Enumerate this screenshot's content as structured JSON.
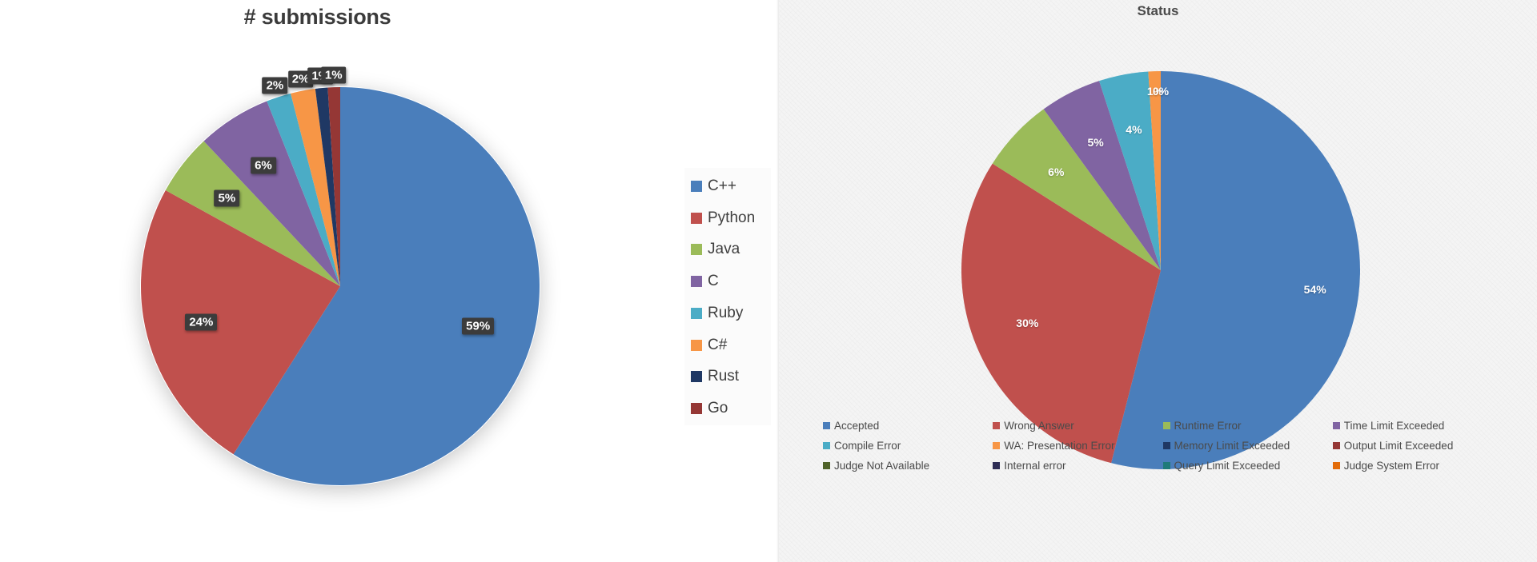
{
  "left": {
    "title": "# submissions",
    "legend_title": "",
    "legend": [
      {
        "label": "C++",
        "color": "#4a7ebb"
      },
      {
        "label": "Python",
        "color": "#c0504d"
      },
      {
        "label": "Java",
        "color": "#9bbb59"
      },
      {
        "label": "C",
        "color": "#8064a2"
      },
      {
        "label": "Ruby",
        "color": "#4bacc6"
      },
      {
        "label": "C#",
        "color": "#f79646"
      },
      {
        "label": "Rust",
        "color": "#1f3864"
      },
      {
        "label": "Go",
        "color": "#953735"
      }
    ]
  },
  "right": {
    "title": "Status",
    "legend": [
      {
        "label": "Accepted",
        "color": "#4a7ebb"
      },
      {
        "label": "Wrong Answer",
        "color": "#c0504d"
      },
      {
        "label": "Runtime Error",
        "color": "#9bbb59"
      },
      {
        "label": "Time Limit Exceeded",
        "color": "#8064a2"
      },
      {
        "label": "Compile Error",
        "color": "#4bacc6"
      },
      {
        "label": "WA: Presentation Error",
        "color": "#f79646"
      },
      {
        "label": "Memory Limit Exceeded",
        "color": "#1f3864"
      },
      {
        "label": "Output Limit Exceeded",
        "color": "#953735"
      },
      {
        "label": "Judge Not Available",
        "color": "#4f6228"
      },
      {
        "label": "Internal error",
        "color": "#2e2d55"
      },
      {
        "label": "Query Limit Exceeded",
        "color": "#1f7a7a"
      },
      {
        "label": "Judge System Error",
        "color": "#e36c0a"
      }
    ]
  },
  "chart_data": [
    {
      "type": "pie",
      "title": "# submissions",
      "legend_position": "right",
      "labels": [
        "C++",
        "Python",
        "Java",
        "C",
        "Ruby",
        "C#",
        "Rust",
        "Go"
      ],
      "values": [
        59,
        24,
        5,
        6,
        2,
        2,
        1,
        1
      ],
      "data_labels": [
        "59%",
        "24%",
        "5%",
        "6%",
        "2%",
        "2%",
        "1%",
        "1%"
      ],
      "colors": [
        "#4a7ebb",
        "#c0504d",
        "#9bbb59",
        "#8064a2",
        "#4bacc6",
        "#f79646",
        "#1f3864",
        "#953735"
      ]
    },
    {
      "type": "pie",
      "title": "Status",
      "legend_position": "bottom",
      "labels": [
        "Accepted",
        "Wrong Answer",
        "Runtime Error",
        "Time Limit Exceeded",
        "Compile Error",
        "WA: Presentation Error",
        "Memory Limit Exceeded",
        "Output Limit Exceeded",
        "Judge Not Available",
        "Internal error",
        "Query Limit Exceeded",
        "Judge System Error"
      ],
      "values": [
        54,
        30,
        6,
        5,
        4,
        1,
        0,
        0,
        0,
        0,
        0,
        0
      ],
      "data_labels": [
        "54%",
        "30%",
        "6%",
        "5%",
        "4%",
        "1%",
        "0%",
        "",
        "",
        "",
        "",
        ""
      ],
      "colors": [
        "#4a7ebb",
        "#c0504d",
        "#9bbb59",
        "#8064a2",
        "#4bacc6",
        "#f79646",
        "#1f3864",
        "#953735",
        "#4f6228",
        "#2e2d55",
        "#1f7a7a",
        "#e36c0a"
      ]
    }
  ]
}
